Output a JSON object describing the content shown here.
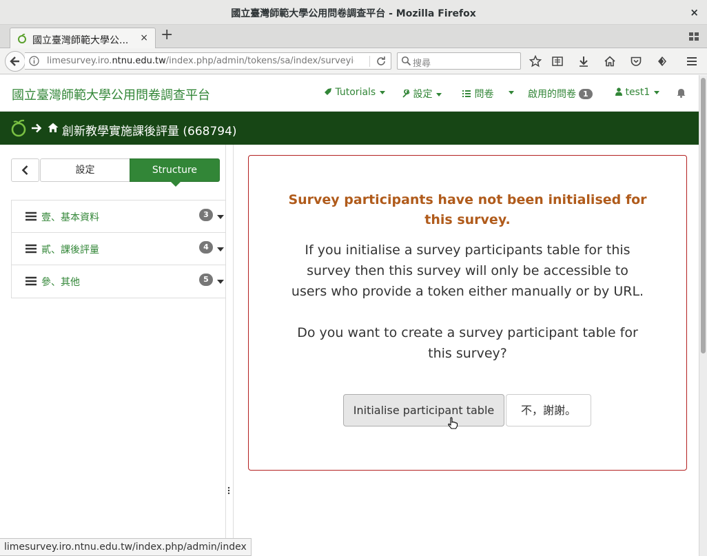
{
  "window": {
    "title": "國立臺灣師範大學公用問卷調查平台 - Mozilla Firefox",
    "close_glyph": "×"
  },
  "tab": {
    "label": "國立臺灣師範大學公...",
    "close_glyph": "×",
    "new_tab_glyph": "+"
  },
  "urlbar": {
    "prefix": "limesurvey.iro.",
    "domain": "ntnu.edu.tw",
    "path": "/index.php/admin/tokens/sa/index/surveyic"
  },
  "search": {
    "placeholder": "搜尋"
  },
  "site": {
    "brand": "國立臺灣師範大學公用問卷調查平台",
    "nav": {
      "tutorials": "Tutorials",
      "settings": "設定",
      "surveys": "問卷",
      "active_surveys": "啟用的問卷",
      "active_count": "1",
      "user": "test1"
    }
  },
  "survey": {
    "title": "創新教學實施課後評量 (668794)"
  },
  "sidebar": {
    "settings_tab": "設定",
    "structure_tab": "Structure",
    "groups": [
      {
        "name": "壹、基本資料",
        "count": "3"
      },
      {
        "name": "貳、課後評量",
        "count": "4"
      },
      {
        "name": "參、其他",
        "count": "5"
      }
    ]
  },
  "panel": {
    "heading": "Survey participants have not been initialised for this survey.",
    "paragraph1": "If you initialise a survey participants table for this survey then this survey will only be accessible to users who provide a token either manually or by URL.",
    "paragraph2": "Do you want to create a survey participant table for this survey?",
    "init_button": "Initialise participant table",
    "no_button": "不，謝謝。"
  },
  "statusbar": {
    "text": "limesurvey.iro.ntnu.edu.tw/index.php/admin/index"
  },
  "colors": {
    "brand_green": "#328637",
    "survey_bar": "#174615",
    "alert_border": "#b31f1f",
    "heading_orange": "#b05b1b"
  }
}
